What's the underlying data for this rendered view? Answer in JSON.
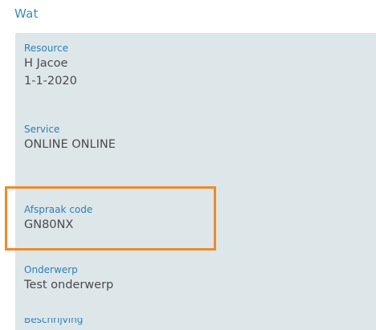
{
  "section": {
    "title": "Wat"
  },
  "fields": {
    "resource": {
      "label": "Resource",
      "value_line1": "H Jacoe",
      "value_line2": "1-1-2020"
    },
    "service": {
      "label": "Service",
      "value": "ONLINE ONLINE"
    },
    "appointment_code": {
      "label": "Afspraak code",
      "value": "GN80NX"
    },
    "subject": {
      "label": "Onderwerp",
      "value": "Test onderwerp"
    },
    "description": {
      "label": "Beschrijving"
    }
  },
  "colors": {
    "panel_bg": "#dde7e9",
    "label": "#2f7fb3",
    "value": "#4a4a4a",
    "highlight": "#ef8a2b"
  }
}
